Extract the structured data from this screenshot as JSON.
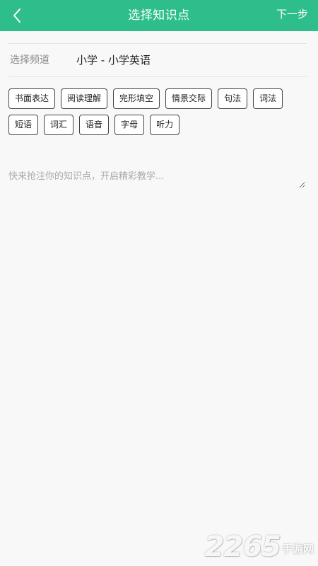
{
  "header": {
    "title": "选择知识点",
    "next_label": "下一步",
    "back_icon": "chevron-left-icon",
    "bg_color": "#2dbe8c"
  },
  "channel": {
    "label": "选择频道",
    "value": "小学 - 小学英语"
  },
  "tags": [
    "书面表达",
    "阅读理解",
    "完形填空",
    "情景交际",
    "句法",
    "词法",
    "短语",
    "词汇",
    "语音",
    "字母",
    "听力"
  ],
  "note": {
    "placeholder": "快来抢注你的知识点，开启精彩教学..."
  },
  "watermark": {
    "number": "2265",
    "text": "手游网"
  }
}
